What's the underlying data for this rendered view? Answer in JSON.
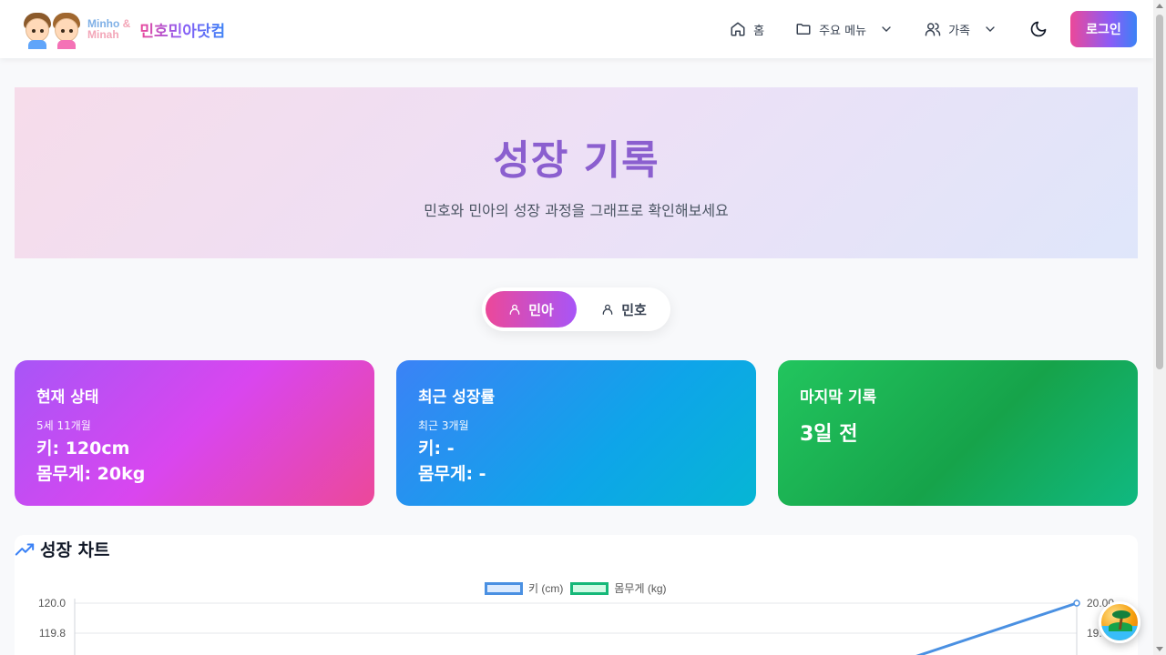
{
  "header": {
    "brand_en_1": "Minho",
    "brand_amp": "&",
    "brand_en_2": "Minah",
    "brand_ko": "민호민아닷컴",
    "nav": [
      {
        "label": "홈",
        "icon": "home-icon"
      },
      {
        "label": "주요 메뉴",
        "icon": "folder-icon",
        "dropdown": true
      },
      {
        "label": "가족",
        "icon": "users-icon",
        "dropdown": true
      }
    ],
    "theme_icon": "moon-icon",
    "login_label": "로그인"
  },
  "hero": {
    "title": "성장 기록",
    "subtitle": "민호와 민아의 성장 과정을 그래프로 확인해보세요"
  },
  "toggle": {
    "options": [
      "민아",
      "민호"
    ],
    "selected": "민아"
  },
  "cards": [
    {
      "title": "현재 상태",
      "sub": "5세 11개월",
      "line1": "키: 120cm",
      "line2": "몸무게: 20kg"
    },
    {
      "title": "최근 성장률",
      "sub": "최근 3개월",
      "line1": "키: -",
      "line2": "몸무게: -"
    },
    {
      "title": "마지막 기록",
      "big": "3일 전"
    }
  ],
  "chart": {
    "heading": "성장 차트",
    "heading_icon": "trending-up-icon"
  },
  "colors": {
    "accent_pink": "#ec4899",
    "accent_purple": "#8b5cf6",
    "accent_blue": "#3b82f6",
    "height_series": "#4a90e2",
    "weight_series": "#16b879"
  },
  "chart_data": {
    "type": "line",
    "series": [
      {
        "name": "키 (cm)",
        "axis": "left"
      },
      {
        "name": "몸무게 (kg)",
        "axis": "right"
      }
    ],
    "y_left_ticks": [
      "120.0",
      "119.8"
    ],
    "y_right_ticks": [
      "20.00",
      "19."
    ],
    "visible_last_point": {
      "height_cm": 120.0,
      "weight_kg": 20.0
    },
    "legend": "top-center",
    "grid": true
  }
}
